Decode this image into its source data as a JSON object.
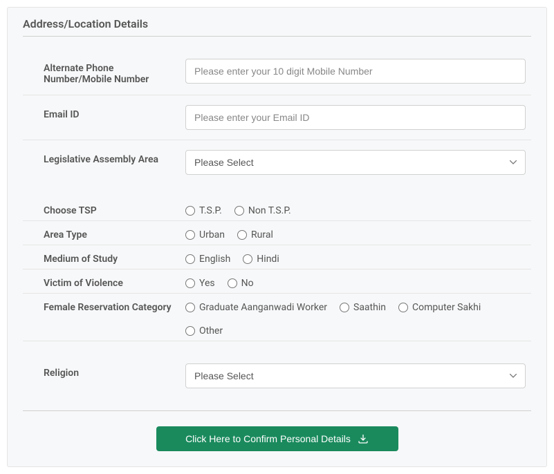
{
  "section_title": "Address/Location Details",
  "fields": {
    "alt_phone": {
      "label": "Alternate Phone Number/Mobile Number",
      "placeholder": "Please enter your 10 digit Mobile Number",
      "value": ""
    },
    "email": {
      "label": "Email ID",
      "placeholder": "Please enter your Email ID",
      "value": ""
    },
    "assembly": {
      "label": "Legislative Assembly Area",
      "selected": "Please Select"
    },
    "tsp": {
      "label": "Choose TSP",
      "options": [
        "T.S.P.",
        "Non T.S.P."
      ]
    },
    "area_type": {
      "label": "Area Type",
      "options": [
        "Urban",
        "Rural"
      ]
    },
    "medium": {
      "label": "Medium of Study",
      "options": [
        "English",
        "Hindi"
      ]
    },
    "violence": {
      "label": "Victim of Violence",
      "options": [
        "Yes",
        "No"
      ]
    },
    "reservation": {
      "label": "Female Reservation Category",
      "options": [
        "Graduate Aanganwadi Worker",
        "Saathin",
        "Computer Sakhi",
        "Other"
      ]
    },
    "religion": {
      "label": "Religion",
      "selected": "Please Select"
    }
  },
  "button": {
    "confirm": "Click Here to Confirm Personal Details"
  }
}
